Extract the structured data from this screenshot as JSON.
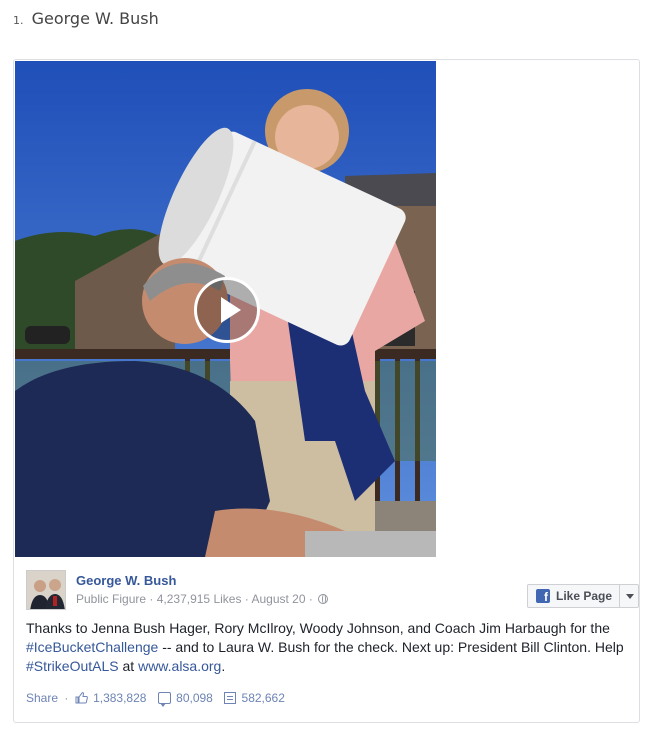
{
  "list": {
    "number": "1.",
    "title": "George W. Bush"
  },
  "post": {
    "page_name": "George W. Bush",
    "category": "Public Figure",
    "likes": "4,237,915 Likes",
    "date": "August 20",
    "meta_sep": "·",
    "like_page_label": "Like Page",
    "text_part1": "Thanks to Jenna Bush Hager, Rory McIlroy, Woody Johnson, and Coach Jim Harbaugh for the ",
    "hashtag1": "#IceBucketChallenge",
    "text_part2": " -- and to Laura W. Bush for the check. Next up: President Bill Clinton. Help ",
    "hashtag2": "#StrikeOutALS",
    "text_part3": " at ",
    "link": "www.alsa.org",
    "text_part4": "."
  },
  "actions": {
    "share_label": "Share",
    "sep": "·",
    "like_count": "1,383,828",
    "comment_count": "80,098",
    "share_count": "582,662"
  },
  "icons": {
    "play": "play-icon",
    "facebook": "facebook-icon",
    "globe": "globe-icon",
    "thumb": "thumbs-up-icon",
    "comment": "comment-icon",
    "share": "share-icon",
    "caret": "chevron-down-icon"
  },
  "colors": {
    "link": "#365899",
    "action": "#6d84b4",
    "muted": "#90949c",
    "fb_blue": "#4267b2"
  }
}
